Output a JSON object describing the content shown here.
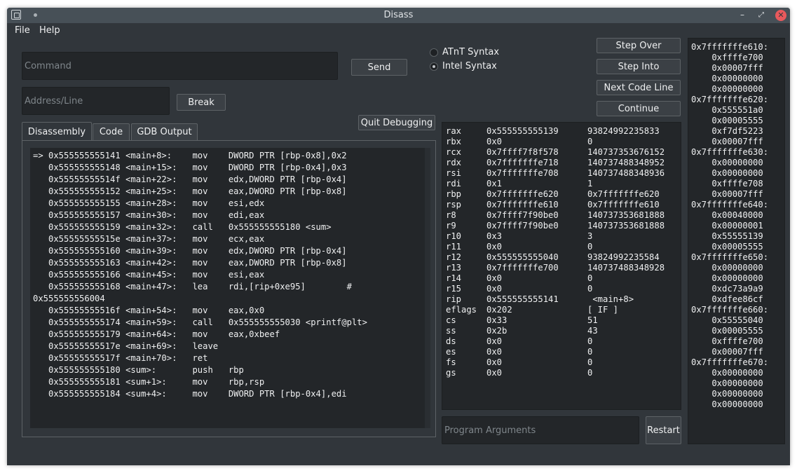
{
  "window": {
    "title": "Disass"
  },
  "menu": {
    "file": "File",
    "help": "Help"
  },
  "command": {
    "placeholder": "Command",
    "send_label": "Send"
  },
  "address": {
    "placeholder": "Address/Line",
    "break_label": "Break"
  },
  "syntax": {
    "att_label": "ATnT Syntax",
    "intel_label": "Intel Syntax",
    "selected": "Intel Syntax"
  },
  "quit_label": "Quit Debugging",
  "steps": {
    "step_over": "Step Over",
    "step_into": "Step Into",
    "next_code_line": "Next Code Line",
    "continue": "Continue"
  },
  "tabs": {
    "disassembly": "Disassembly",
    "code": "Code",
    "gdb_output": "GDB Output",
    "active": "Disassembly"
  },
  "disassembly_lines": [
    "=> 0x555555555141 <main+8>:    mov    DWORD PTR [rbp-0x8],0x2",
    "   0x555555555148 <main+15>:   mov    DWORD PTR [rbp-0x4],0x3",
    "   0x55555555514f <main+22>:   mov    edx,DWORD PTR [rbp-0x4]",
    "   0x555555555152 <main+25>:   mov    eax,DWORD PTR [rbp-0x8]",
    "   0x555555555155 <main+28>:   mov    esi,edx",
    "   0x555555555157 <main+30>:   mov    edi,eax",
    "   0x555555555159 <main+32>:   call   0x555555555180 <sum>",
    "   0x55555555515e <main+37>:   mov    ecx,eax",
    "   0x555555555160 <main+39>:   mov    edx,DWORD PTR [rbp-0x4]",
    "   0x555555555163 <main+42>:   mov    eax,DWORD PTR [rbp-0x8]",
    "   0x555555555166 <main+45>:   mov    esi,eax",
    "   0x555555555168 <main+47>:   lea    rdi,[rip+0xe95]        #",
    "0x555555556004",
    "   0x55555555516f <main+54>:   mov    eax,0x0",
    "   0x555555555174 <main+59>:   call   0x555555555030 <printf@plt>",
    "   0x555555555179 <main+64>:   mov    eax,0xbeef",
    "   0x55555555517e <main+69>:   leave",
    "   0x55555555517f <main+70>:   ret",
    "   0x555555555180 <sum>:       push   rbp",
    "   0x555555555181 <sum+1>:     mov    rbp,rsp",
    "   0x555555555184 <sum+4>:     mov    DWORD PTR [rbp-0x4],edi"
  ],
  "registers": [
    {
      "name": "rax",
      "hex": "0x555555555139",
      "value": "93824992235833"
    },
    {
      "name": "rbx",
      "hex": "0x0",
      "value": "0"
    },
    {
      "name": "rcx",
      "hex": "0x7ffff7f8f578",
      "value": "140737353676152"
    },
    {
      "name": "rdx",
      "hex": "0x7fffffffe718",
      "value": "140737488348952"
    },
    {
      "name": "rsi",
      "hex": "0x7fffffffe708",
      "value": "140737488348936"
    },
    {
      "name": "rdi",
      "hex": "0x1",
      "value": "1"
    },
    {
      "name": "rbp",
      "hex": "0x7fffffffe620",
      "value": "0x7fffffffe620"
    },
    {
      "name": "rsp",
      "hex": "0x7fffffffe610",
      "value": "0x7fffffffe610"
    },
    {
      "name": "r8",
      "hex": "0x7ffff7f90be0",
      "value": "140737353681888"
    },
    {
      "name": "r9",
      "hex": "0x7ffff7f90be0",
      "value": "140737353681888"
    },
    {
      "name": "r10",
      "hex": "0x3",
      "value": "3"
    },
    {
      "name": "r11",
      "hex": "0x0",
      "value": "0"
    },
    {
      "name": "r12",
      "hex": "0x555555555040",
      "value": "93824992235584"
    },
    {
      "name": "r13",
      "hex": "0x7fffffffe700",
      "value": "140737488348928"
    },
    {
      "name": "r14",
      "hex": "0x0",
      "value": "0"
    },
    {
      "name": "r15",
      "hex": "0x0",
      "value": "0"
    },
    {
      "name": "rip",
      "hex": "0x555555555141",
      "value": " <main+8>"
    },
    {
      "name": "eflags",
      "hex": "0x202",
      "value": "[ IF ]"
    },
    {
      "name": "cs",
      "hex": "0x33",
      "value": "51"
    },
    {
      "name": "ss",
      "hex": "0x2b",
      "value": "43"
    },
    {
      "name": "ds",
      "hex": "0x0",
      "value": "0"
    },
    {
      "name": "es",
      "hex": "0x0",
      "value": "0"
    },
    {
      "name": "fs",
      "hex": "0x0",
      "value": "0"
    },
    {
      "name": "gs",
      "hex": "0x0",
      "value": "0"
    }
  ],
  "program_args": {
    "placeholder": "Program Arguments",
    "restart_label": "Restart"
  },
  "memory_lines": [
    "0x7fffffffe610:",
    "    0xffffe700",
    "    0x00007fff",
    "    0x00000000",
    "    0x00000000",
    "0x7fffffffe620:",
    "    0x555551a0",
    "    0x00005555",
    "    0xf7df5223",
    "    0x00007fff",
    "0x7fffffffe630:",
    "    0x00000000",
    "    0x00000000",
    "    0xffffe708",
    "    0x00007fff",
    "0x7fffffffe640:",
    "    0x00040000",
    "    0x00000001",
    "    0x55555139",
    "    0x00005555",
    "0x7fffffffe650:",
    "    0x00000000",
    "    0x00000000",
    "    0xdc73a9a9",
    "    0xdfee86cf",
    "0x7fffffffe660:",
    "    0x55555040",
    "    0x00005555",
    "    0xffffe700",
    "    0x00007fff",
    "0x7fffffffe670:",
    "    0x00000000",
    "    0x00000000",
    "    0x00000000",
    "    0x00000000"
  ]
}
